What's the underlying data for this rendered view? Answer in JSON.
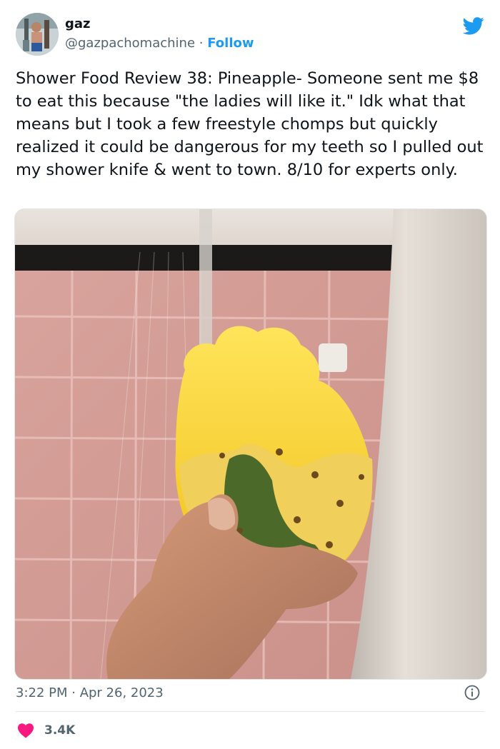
{
  "author": {
    "name": "gaz",
    "handle": "@gazpachomachine",
    "separator": "·",
    "follow_label": "Follow"
  },
  "tweet": {
    "text": "Shower Food Review 38: Pineapple- Someone sent me $8 to eat this because \"the ladies will like it.\" Idk what that means but I took a few freestyle chomps but quickly realized it could be dangerous for my teeth so I pulled out my shower knife & went to town. 8/10 for experts only.",
    "timestamp": "3:22 PM · Apr 26, 2023",
    "likes": "3.4K"
  },
  "icons": {
    "brand": "twitter-bird-icon",
    "info": "info-icon",
    "like": "heart-icon"
  },
  "colors": {
    "accent": "#1d9bf0",
    "like": "#f91880",
    "secondary_text": "#536471"
  }
}
